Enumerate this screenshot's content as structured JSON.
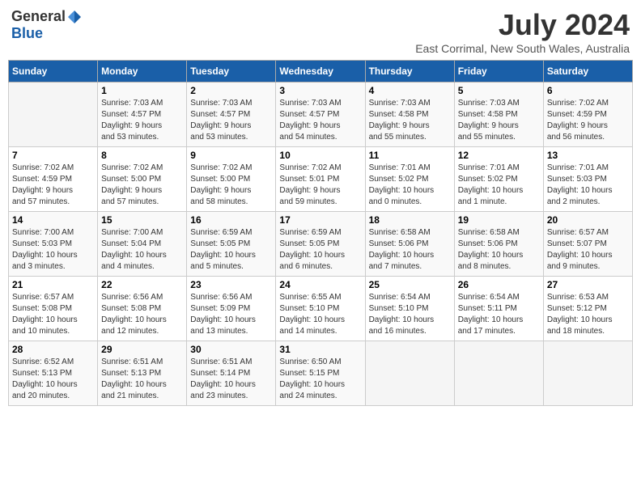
{
  "logo": {
    "general": "General",
    "blue": "Blue"
  },
  "title": {
    "month": "July 2024",
    "location": "East Corrimal, New South Wales, Australia"
  },
  "days_of_week": [
    "Sunday",
    "Monday",
    "Tuesday",
    "Wednesday",
    "Thursday",
    "Friday",
    "Saturday"
  ],
  "weeks": [
    [
      {
        "day": "",
        "info": ""
      },
      {
        "day": "1",
        "info": "Sunrise: 7:03 AM\nSunset: 4:57 PM\nDaylight: 9 hours\nand 53 minutes."
      },
      {
        "day": "2",
        "info": "Sunrise: 7:03 AM\nSunset: 4:57 PM\nDaylight: 9 hours\nand 53 minutes."
      },
      {
        "day": "3",
        "info": "Sunrise: 7:03 AM\nSunset: 4:57 PM\nDaylight: 9 hours\nand 54 minutes."
      },
      {
        "day": "4",
        "info": "Sunrise: 7:03 AM\nSunset: 4:58 PM\nDaylight: 9 hours\nand 55 minutes."
      },
      {
        "day": "5",
        "info": "Sunrise: 7:03 AM\nSunset: 4:58 PM\nDaylight: 9 hours\nand 55 minutes."
      },
      {
        "day": "6",
        "info": "Sunrise: 7:02 AM\nSunset: 4:59 PM\nDaylight: 9 hours\nand 56 minutes."
      }
    ],
    [
      {
        "day": "7",
        "info": "Sunrise: 7:02 AM\nSunset: 4:59 PM\nDaylight: 9 hours\nand 57 minutes."
      },
      {
        "day": "8",
        "info": "Sunrise: 7:02 AM\nSunset: 5:00 PM\nDaylight: 9 hours\nand 57 minutes."
      },
      {
        "day": "9",
        "info": "Sunrise: 7:02 AM\nSunset: 5:00 PM\nDaylight: 9 hours\nand 58 minutes."
      },
      {
        "day": "10",
        "info": "Sunrise: 7:02 AM\nSunset: 5:01 PM\nDaylight: 9 hours\nand 59 minutes."
      },
      {
        "day": "11",
        "info": "Sunrise: 7:01 AM\nSunset: 5:02 PM\nDaylight: 10 hours\nand 0 minutes."
      },
      {
        "day": "12",
        "info": "Sunrise: 7:01 AM\nSunset: 5:02 PM\nDaylight: 10 hours\nand 1 minute."
      },
      {
        "day": "13",
        "info": "Sunrise: 7:01 AM\nSunset: 5:03 PM\nDaylight: 10 hours\nand 2 minutes."
      }
    ],
    [
      {
        "day": "14",
        "info": "Sunrise: 7:00 AM\nSunset: 5:03 PM\nDaylight: 10 hours\nand 3 minutes."
      },
      {
        "day": "15",
        "info": "Sunrise: 7:00 AM\nSunset: 5:04 PM\nDaylight: 10 hours\nand 4 minutes."
      },
      {
        "day": "16",
        "info": "Sunrise: 6:59 AM\nSunset: 5:05 PM\nDaylight: 10 hours\nand 5 minutes."
      },
      {
        "day": "17",
        "info": "Sunrise: 6:59 AM\nSunset: 5:05 PM\nDaylight: 10 hours\nand 6 minutes."
      },
      {
        "day": "18",
        "info": "Sunrise: 6:58 AM\nSunset: 5:06 PM\nDaylight: 10 hours\nand 7 minutes."
      },
      {
        "day": "19",
        "info": "Sunrise: 6:58 AM\nSunset: 5:06 PM\nDaylight: 10 hours\nand 8 minutes."
      },
      {
        "day": "20",
        "info": "Sunrise: 6:57 AM\nSunset: 5:07 PM\nDaylight: 10 hours\nand 9 minutes."
      }
    ],
    [
      {
        "day": "21",
        "info": "Sunrise: 6:57 AM\nSunset: 5:08 PM\nDaylight: 10 hours\nand 10 minutes."
      },
      {
        "day": "22",
        "info": "Sunrise: 6:56 AM\nSunset: 5:08 PM\nDaylight: 10 hours\nand 12 minutes."
      },
      {
        "day": "23",
        "info": "Sunrise: 6:56 AM\nSunset: 5:09 PM\nDaylight: 10 hours\nand 13 minutes."
      },
      {
        "day": "24",
        "info": "Sunrise: 6:55 AM\nSunset: 5:10 PM\nDaylight: 10 hours\nand 14 minutes."
      },
      {
        "day": "25",
        "info": "Sunrise: 6:54 AM\nSunset: 5:10 PM\nDaylight: 10 hours\nand 16 minutes."
      },
      {
        "day": "26",
        "info": "Sunrise: 6:54 AM\nSunset: 5:11 PM\nDaylight: 10 hours\nand 17 minutes."
      },
      {
        "day": "27",
        "info": "Sunrise: 6:53 AM\nSunset: 5:12 PM\nDaylight: 10 hours\nand 18 minutes."
      }
    ],
    [
      {
        "day": "28",
        "info": "Sunrise: 6:52 AM\nSunset: 5:13 PM\nDaylight: 10 hours\nand 20 minutes."
      },
      {
        "day": "29",
        "info": "Sunrise: 6:51 AM\nSunset: 5:13 PM\nDaylight: 10 hours\nand 21 minutes."
      },
      {
        "day": "30",
        "info": "Sunrise: 6:51 AM\nSunset: 5:14 PM\nDaylight: 10 hours\nand 23 minutes."
      },
      {
        "day": "31",
        "info": "Sunrise: 6:50 AM\nSunset: 5:15 PM\nDaylight: 10 hours\nand 24 minutes."
      },
      {
        "day": "",
        "info": ""
      },
      {
        "day": "",
        "info": ""
      },
      {
        "day": "",
        "info": ""
      }
    ]
  ]
}
